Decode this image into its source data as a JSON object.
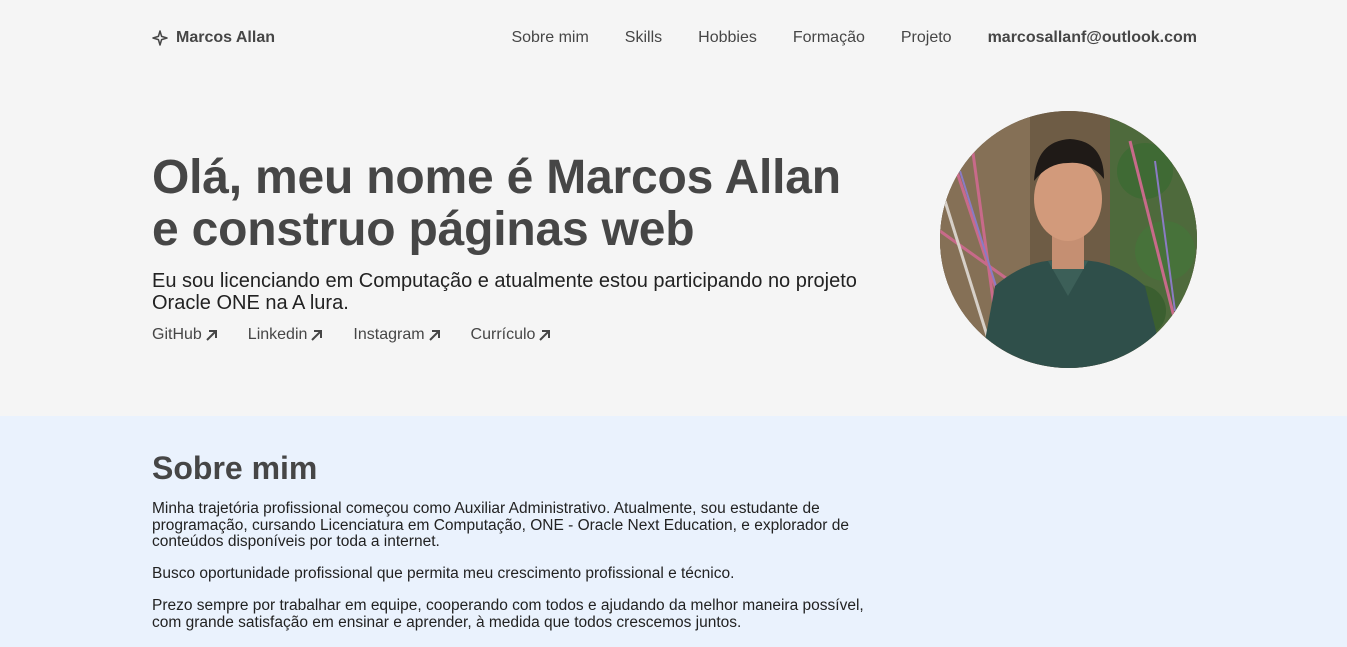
{
  "header": {
    "brand": "Marcos Allan",
    "nav": [
      {
        "label": "Sobre mim"
      },
      {
        "label": "Skills"
      },
      {
        "label": "Hobbies"
      },
      {
        "label": "Formação"
      },
      {
        "label": "Projeto"
      }
    ],
    "email": "marcosallanf@outlook.com"
  },
  "hero": {
    "title_line1": "Olá, meu nome é Marcos Allan",
    "title_line2": "e construo páginas web",
    "subtitle": "Eu sou licenciando em Computação e atualmente estou participando no projeto Oracle ONE na A lura.",
    "links": [
      {
        "label": "GitHub"
      },
      {
        "label": "Linkedin"
      },
      {
        "label": "Instagram"
      },
      {
        "label": "Currículo"
      }
    ],
    "avatar_alt": "profile-photo"
  },
  "about": {
    "heading": "Sobre mim",
    "paragraphs": [
      "Minha trajetória profissional começou como Auxiliar Administrativo. Atualmente, sou estudante de programação, cursando Licenciatura em Computação, ONE - Oracle Next Education, e explorador de conteúdos disponíveis por toda a internet.",
      "Busco oportunidade profissional que permita meu crescimento profissional e técnico.",
      "Prezo sempre por trabalhar em equipe, cooperando com todos e ajudando da melhor maneira possível, com grande satisfação em ensinar e aprender, à medida que todos crescemos juntos."
    ]
  },
  "colors": {
    "text": "#464646",
    "background": "#f5f5f5",
    "about_background": "#eaf2fd"
  }
}
